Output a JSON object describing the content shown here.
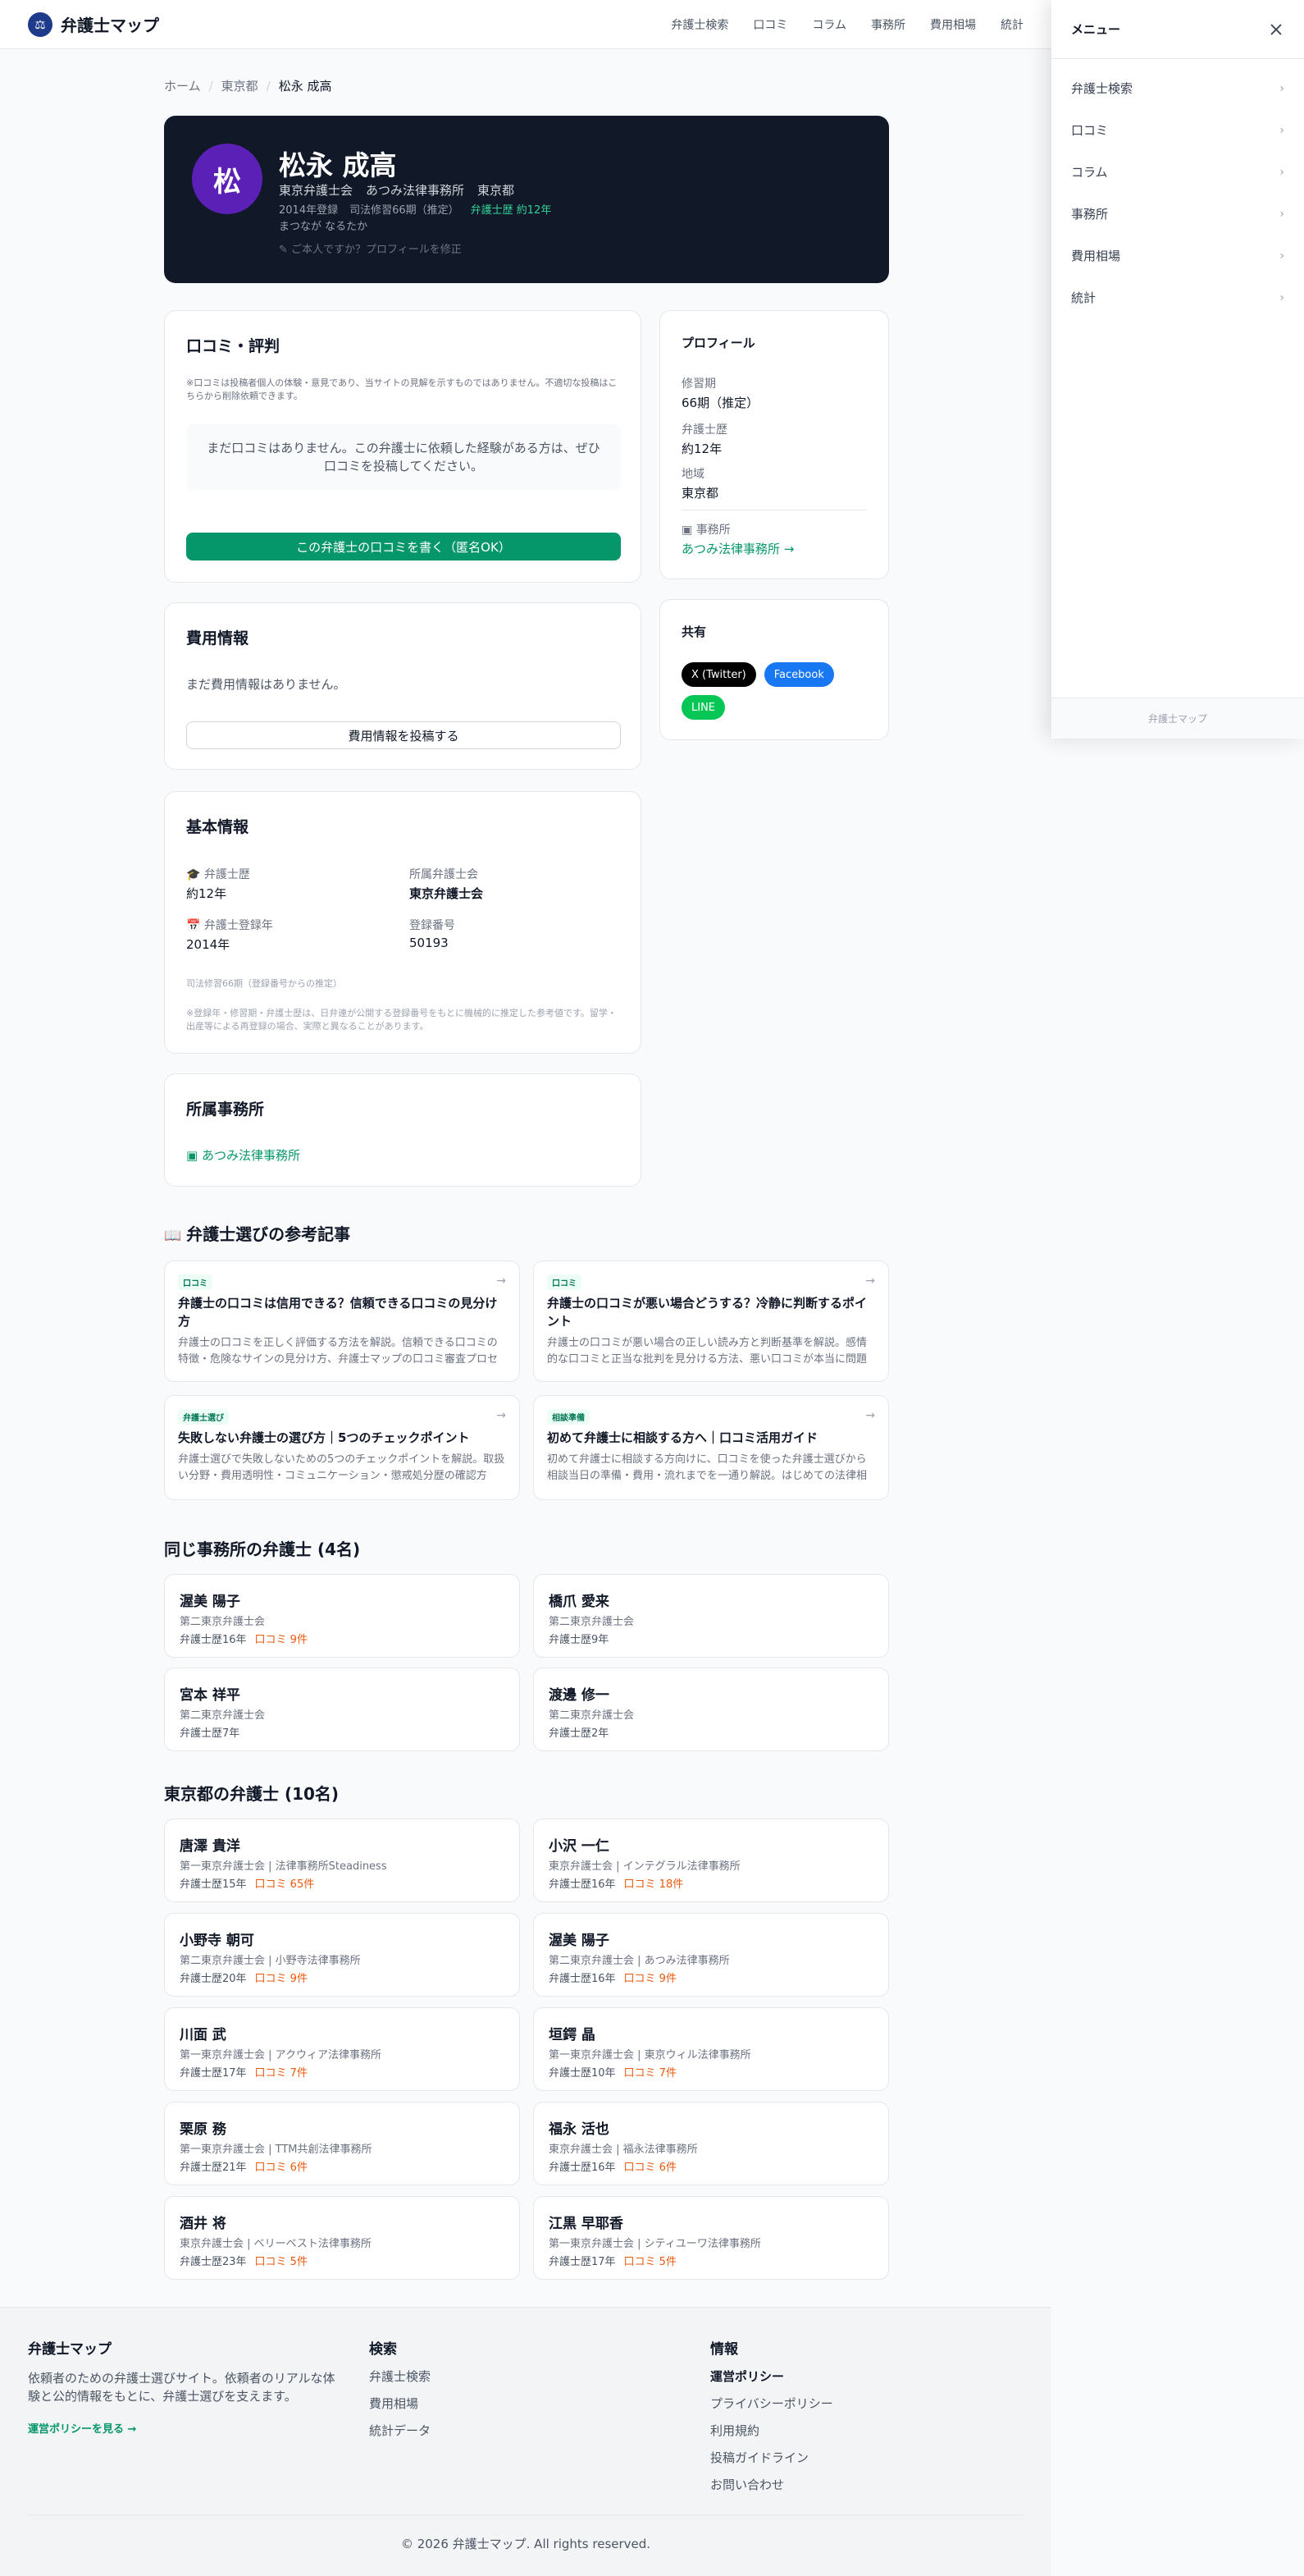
{
  "header": {
    "logo_glyph": "⚖",
    "site_name": "弁護士マップ",
    "nav": [
      "弁護士検索",
      "口コミ",
      "コラム",
      "事務所",
      "費用相場",
      "統計"
    ]
  },
  "breadcrumb": [
    "ホーム",
    "東京都",
    "松永 成高"
  ],
  "hero": {
    "initial": "松",
    "name": "松永 成高",
    "bar": "東京弁護士会",
    "firm": "あつみ法律事務所",
    "region": "東京都",
    "registered": "2014年登録",
    "term": "司法修習66期（推定）",
    "experience": "弁護士歴 約12年",
    "kana": "まつなが なるたか",
    "edit_link": "ご本人ですか？プロフィールを修正"
  },
  "reviews": {
    "title": "口コミ・評判",
    "disclaimer": "※口コミは投稿者個人の体験・意見であり、当サイトの見解を示すものではありません。不適切な投稿はこちらから削除依頼できます。",
    "empty": "まだ口コミはありません。この弁護士に依頼した経験がある方は、ぜひ口コミを投稿してください。",
    "cta": "この弁護士の口コミを書く（匿名OK）"
  },
  "fees": {
    "title": "費用情報",
    "empty": "まだ費用情報はありません。",
    "cta": "費用情報を投稿する"
  },
  "basic": {
    "title": "基本情報",
    "exp_label": "弁護士歴",
    "exp_value": "約12年",
    "bar_label": "所属弁護士会",
    "bar_value": "東京弁護士会",
    "reg_label": "弁護士登録年",
    "reg_value": "2014年",
    "num_label": "登録番号",
    "num_value": "50193",
    "term_note": "司法修習66期（登録番号からの推定）",
    "footnote": "※登録年・修習期・弁護士歴は、日弁連が公開する登録番号をもとに機械的に推定した参考値です。留学・出産等による再登録の場合、実際と異なることがあります。"
  },
  "office": {
    "title": "所属事務所",
    "firm": "あつみ法律事務所"
  },
  "profile": {
    "title": "プロフィール",
    "term_label": "修習期",
    "term_value": "66期（推定）",
    "exp_label": "弁護士歴",
    "exp_value": "約12年",
    "region_label": "地域",
    "region_value": "東京都",
    "office_label": "事務所",
    "office_link": "あつみ法律事務所 →"
  },
  "share": {
    "title": "共有",
    "twitter": "X (Twitter)",
    "facebook": "Facebook",
    "line": "LINE"
  },
  "articles": {
    "title": "弁護士選びの参考記事",
    "items": [
      {
        "tag": "口コミ",
        "title": "弁護士の口コミは信用できる？信頼できる口コミの見分け方",
        "desc": "弁護士の口コミを正しく評価する方法を解説。信頼できる口コミの特徴・危険なサインの見分け方、弁護士マップの口コミ審査プロセス…"
      },
      {
        "tag": "口コミ",
        "title": "弁護士の口コミが悪い場合どうする？冷静に判断するポイント",
        "desc": "弁護士の口コミが悪い場合の正しい読み方と判断基準を解説。感情的な口コミと正当な批判を見分ける方法、悪い口コミが本当に問題に…"
      },
      {
        "tag": "弁護士選び",
        "title": "失敗しない弁護士の選び方｜5つのチェックポイント",
        "desc": "弁護士選びで失敗しないための5つのチェックポイントを解説。取扱い分野・費用透明性・コミュニケーション・懲戒処分歴の確認方法。"
      },
      {
        "tag": "相談準備",
        "title": "初めて弁護士に相談する方へ｜口コミ活用ガイド",
        "desc": "初めて弁護士に相談する方向けに、口コミを使った弁護士選びから相談当日の準備・費用・流れまでを一通り解説。はじめての法律相談…"
      }
    ]
  },
  "same_office": {
    "title": "同じ事務所の弁護士 (4名)",
    "items": [
      {
        "name": "渥美 陽子",
        "bar": "第二東京弁護士会",
        "years": "弁護士歴16年",
        "reviews": "口コミ 9件"
      },
      {
        "name": "橋爪 愛来",
        "bar": "第二東京弁護士会",
        "years": "弁護士歴9年",
        "reviews": ""
      },
      {
        "name": "宮本 祥平",
        "bar": "第二東京弁護士会",
        "years": "弁護士歴7年",
        "reviews": ""
      },
      {
        "name": "渡邊 修一",
        "bar": "第二東京弁護士会",
        "years": "弁護士歴2年",
        "reviews": ""
      }
    ]
  },
  "region_lawyers": {
    "title": "東京都の弁護士 (10名)",
    "items": [
      {
        "name": "唐澤 貴洋",
        "bar": "第一東京弁護士会 | 法律事務所Steadiness",
        "years": "弁護士歴15年",
        "reviews": "口コミ 65件"
      },
      {
        "name": "小沢 一仁",
        "bar": "東京弁護士会 | インテグラル法律事務所",
        "years": "弁護士歴16年",
        "reviews": "口コミ 18件"
      },
      {
        "name": "小野寺 朝可",
        "bar": "第二東京弁護士会 | 小野寺法律事務所",
        "years": "弁護士歴20年",
        "reviews": "口コミ 9件"
      },
      {
        "name": "渥美 陽子",
        "bar": "第二東京弁護士会 | あつみ法律事務所",
        "years": "弁護士歴16年",
        "reviews": "口コミ 9件"
      },
      {
        "name": "川面 武",
        "bar": "第一東京弁護士会 | アクウィア法律事務所",
        "years": "弁護士歴17年",
        "reviews": "口コミ 7件"
      },
      {
        "name": "垣鍔 晶",
        "bar": "第一東京弁護士会 | 東京ウィル法律事務所",
        "years": "弁護士歴10年",
        "reviews": "口コミ 7件"
      },
      {
        "name": "栗原 務",
        "bar": "第一東京弁護士会 | TTM共創法律事務所",
        "years": "弁護士歴21年",
        "reviews": "口コミ 6件"
      },
      {
        "name": "福永 活也",
        "bar": "東京弁護士会 | 福永法律事務所",
        "years": "弁護士歴16年",
        "reviews": "口コミ 6件"
      },
      {
        "name": "酒井 将",
        "bar": "東京弁護士会 | ベリーベスト法律事務所",
        "years": "弁護士歴23年",
        "reviews": "口コミ 5件"
      },
      {
        "name": "江黒 早耶香",
        "bar": "第一東京弁護士会 | シティユーワ法律事務所",
        "years": "弁護士歴17年",
        "reviews": "口コミ 5件"
      }
    ]
  },
  "footer": {
    "brand": "弁護士マップ",
    "desc": "依頼者のための弁護士選びサイト。依頼者のリアルな体験と公的情報をもとに、弁護士選びを支えます。",
    "policy_link": "運営ポリシーを見る →",
    "search_title": "検索",
    "search_links": [
      "弁護士検索",
      "費用相場",
      "統計データ"
    ],
    "info_title": "情報",
    "info_links": [
      "運営ポリシー",
      "プライバシーポリシー",
      "利用規約",
      "投稿ガイドライン",
      "お問い合わせ"
    ],
    "copyright": "© 2026 弁護士マップ. All rights reserved."
  },
  "menu": {
    "title": "メニュー",
    "items": [
      "弁護士検索",
      "口コミ",
      "コラム",
      "事務所",
      "費用相場",
      "統計"
    ],
    "footer": "弁護士マップ"
  }
}
